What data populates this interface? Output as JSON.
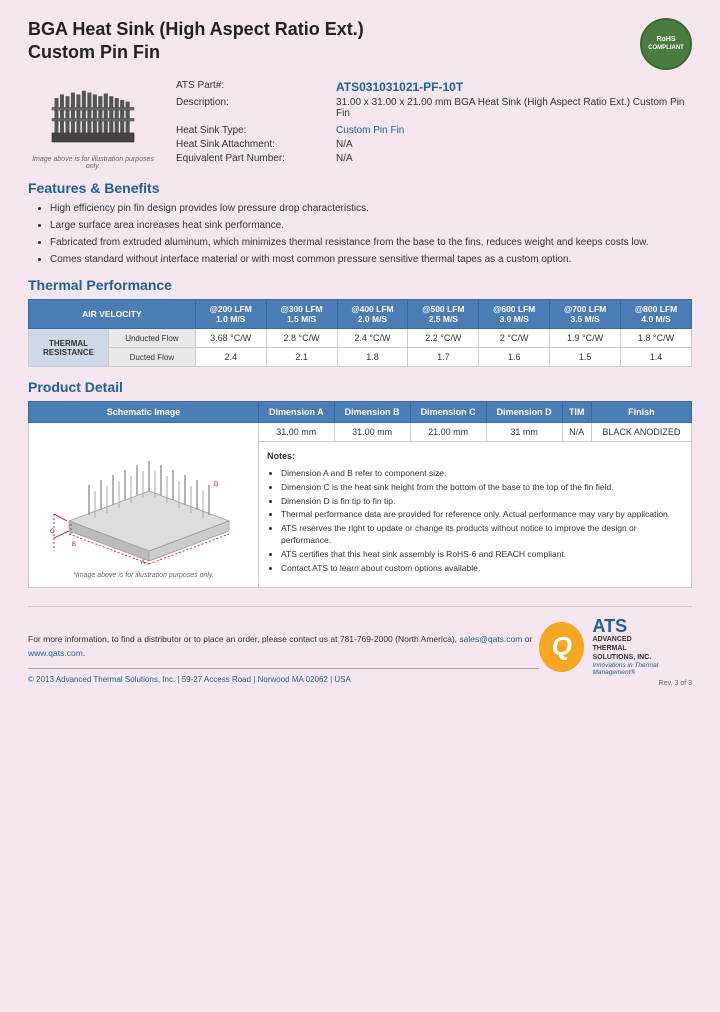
{
  "header": {
    "title_line1": "BGA Heat Sink (High Aspect Ratio Ext.)",
    "title_line2": "Custom Pin Fin",
    "rohs_line1": "RoHS",
    "rohs_line2": "COMPLIANT"
  },
  "specs": {
    "ats_part_label": "ATS Part#:",
    "ats_part_value": "ATS031031021-PF-10T",
    "description_label": "Description:",
    "description_value": "31.00 x 31.00 x 21.00 mm BGA Heat Sink (High Aspect Ratio Ext.) Custom Pin Fin",
    "heat_sink_type_label": "Heat Sink Type:",
    "heat_sink_type_value": "Custom Pin Fin",
    "attachment_label": "Heat Sink Attachment:",
    "attachment_value": "N/A",
    "equivalent_label": "Equivalent Part Number:",
    "equivalent_value": "N/A",
    "image_caption": "Image above is for illustration purposes only."
  },
  "features": {
    "section_title": "Features & Benefits",
    "items": [
      "High efficiency pin fin design provides low pressure drop characteristics.",
      "Large surface area increases heat sink performance.",
      "Fabricated from extruded aluminum, which minimizes thermal resistance from the base to the fins, reduces weight and keeps costs low.",
      "Comes standard without interface material or with most common pressure sensitive thermal tapes as a custom option."
    ]
  },
  "thermal": {
    "section_title": "Thermal Performance",
    "header_row": {
      "col0": "AIR VELOCITY",
      "col1": "@200 LFM\n1.0 M/S",
      "col2": "@300 LFM\n1.5 M/S",
      "col3": "@400 LFM\n2.0 M/S",
      "col4": "@500 LFM\n2.5 M/S",
      "col5": "@600 LFM\n3.0 M/S",
      "col6": "@700 LFM\n3.5 M/S",
      "col7": "@800 LFM\n4.0 M/S"
    },
    "row_label": "THERMAL RESISTANCE",
    "unducted_label": "Unducted Flow",
    "ducted_label": "Ducted Flow",
    "unducted_values": [
      "3.68 °C/W",
      "2.8 °C/W",
      "2.4 °C/W",
      "2.2 °C/W",
      "2 °C/W",
      "1.9 °C/W",
      "1.8 °C/W"
    ],
    "ducted_values": [
      "2.4",
      "2.1",
      "1.8",
      "1.7",
      "1.6",
      "1.5",
      "1.4"
    ]
  },
  "product_detail": {
    "section_title": "Product Detail",
    "schematic_label": "Schematic Image",
    "dim_a_label": "Dimension A",
    "dim_b_label": "Dimension B",
    "dim_c_label": "Dimension C",
    "dim_d_label": "Dimension D",
    "tim_label": "TIM",
    "finish_label": "Finish",
    "dim_a_value": "31.00 mm",
    "dim_b_value": "31.00 mm",
    "dim_c_value": "21.00 mm",
    "dim_d_value": "31 mm",
    "tim_value": "N/A",
    "finish_value": "BLACK ANODIZED",
    "image_caption": "*Image above is for illustration purposes only.",
    "notes_title": "Notes:",
    "notes": [
      "Dimension A and B refer to component size.",
      "Dimension C is the heat sink height from the bottom of the base to the top of the fin field.",
      "Dimension D is fin tip to fin tip.",
      "Thermal performance data are provided for reference only. Actual performance may vary by application.",
      "ATS reserves the right to update or change its products without notice to improve the design or performance.",
      "ATS certifies that this heat sink assembly is RoHS-6 and REACH compliant.",
      "Contact ATS to learn about custom options available."
    ]
  },
  "footer": {
    "contact_text": "For more information, to find a distributor or to place an order, please contact us at",
    "phone": "781-769-2000 (North America),",
    "email": "sales@qats.com",
    "email_conjunction": " or ",
    "website": "www.qats.com",
    "copyright": "© 2013 Advanced Thermal Solutions, Inc. | 59-27 Access Road | Norwood MA  02062 | USA",
    "ats_q": "Q",
    "ats_name": "ATS",
    "ats_full_line1": "ADVANCED",
    "ats_full_line2": "THERMAL",
    "ats_full_line3": "SOLUTIONS, INC.",
    "ats_tagline": "Innovations in Thermal Management®",
    "page_number": "Rev. 3 of 3"
  }
}
